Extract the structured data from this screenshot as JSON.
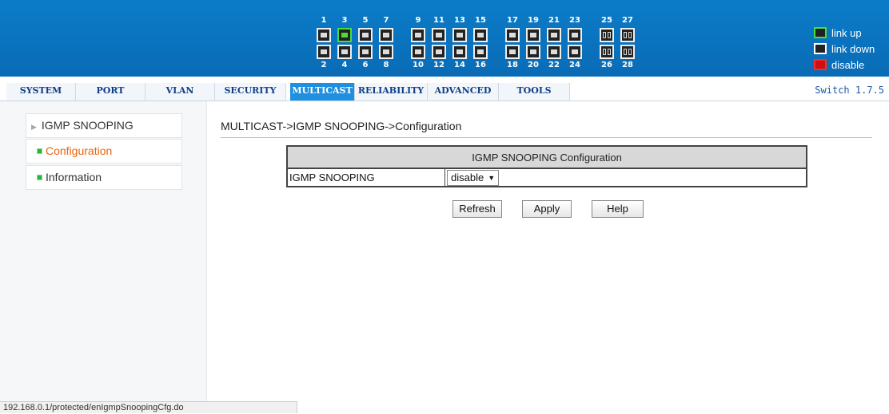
{
  "ports": {
    "top_labels": [
      "1",
      "3",
      "5",
      "7",
      "9",
      "11",
      "13",
      "15",
      "17",
      "19",
      "21",
      "23",
      "25",
      "27"
    ],
    "bottom_labels": [
      "2",
      "4",
      "6",
      "8",
      "10",
      "12",
      "14",
      "16",
      "18",
      "20",
      "22",
      "24",
      "26",
      "28"
    ],
    "link_up_ports": [
      "3"
    ]
  },
  "legend": {
    "link_up": "link up",
    "link_down": "link down",
    "disable": "disable"
  },
  "nav": {
    "tabs": [
      "SYSTEM",
      "PORT",
      "VLAN",
      "SECURITY",
      "MULTICAST",
      "RELIABILITY",
      "ADVANCED",
      "TOOLS"
    ],
    "active": "MULTICAST",
    "version": "Switch 1.7.5"
  },
  "sidebar": {
    "group": "IGMP SNOOPING",
    "items": [
      "Configuration",
      "Information"
    ],
    "selected": "Configuration"
  },
  "main": {
    "breadcrumb": "MULTICAST->IGMP SNOOPING->Configuration",
    "table_title": "IGMP SNOOPING Configuration",
    "row_label": "IGMP SNOOPING",
    "row_value": "disable"
  },
  "buttons": {
    "refresh": "Refresh",
    "apply": "Apply",
    "help": "Help"
  },
  "status_bar": "192.168.0.1/protected/enIgmpSnoopingCfg.do",
  "colors": {
    "banner": "#0a6bb5",
    "active_tab": "#1f8fe0",
    "link_up": "#4ddd3a",
    "disable": "#cc1111",
    "selected_item": "#e8630f"
  }
}
